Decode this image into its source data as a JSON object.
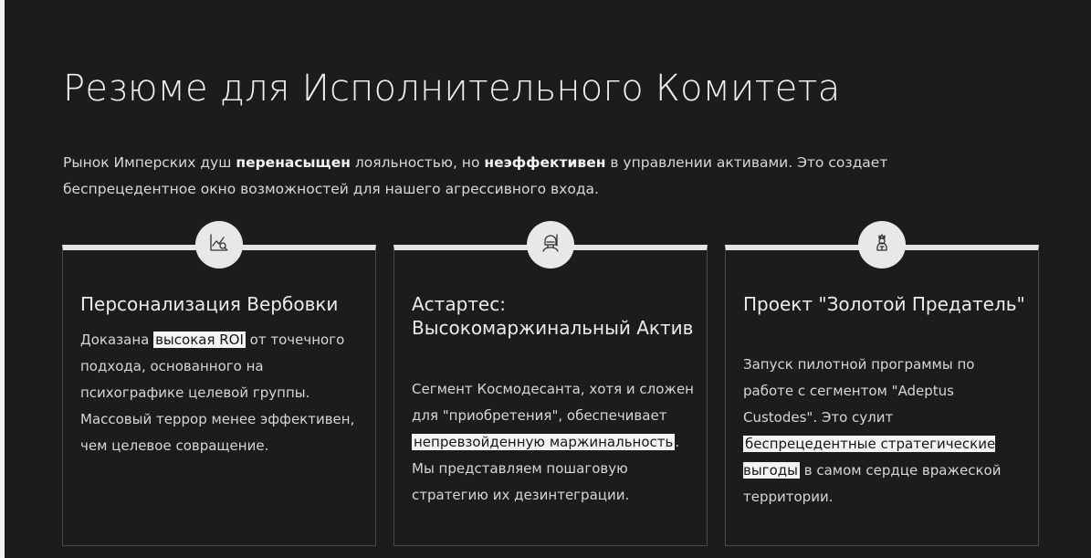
{
  "header": {
    "title": "Резюме для Исполнительного Комитета"
  },
  "intro": {
    "part1": "Рынок Имперских душ ",
    "bold1": "перенасыщен",
    "part2": " лояльностью, но ",
    "bold2": "неэффективен",
    "part3": " в управлении активами. Это создает беспрецедентное окно возможностей для нашего агрессивного входа."
  },
  "cards": [
    {
      "icon": "chart-analysis-icon",
      "title": "Персонализация Вербовки",
      "body_pre": "Доказана ",
      "highlight": "высокая ROI",
      "body_post": " от точечного подхода, основанного на психографике целевой группы. Массовый террор менее эффективен, чем целевое совращение."
    },
    {
      "icon": "armored-warrior-icon",
      "title": "Астартес: Высокомаржинальный Актив",
      "body_pre": "Сегмент Космодесанта, хотя и сложен для \"приобретения\", обеспечивает ",
      "highlight": "непревзойденную маржинальность",
      "body_post": ". Мы представляем пошаговую стратегию их дезинтеграции."
    },
    {
      "icon": "golden-guardian-icon",
      "title": "Проект \"Золотой Предатель\"",
      "body_pre": "Запуск пилотной программы по работе с сегментом \"Adeptus Custodes\". Это сулит ",
      "highlight": "беспрецедентные стратегические выгоды",
      "body_post": " в самом сердце вражеской территории."
    }
  ],
  "colors": {
    "background": "#1c1c1c",
    "accent": "#e6e6e6",
    "text": "#d6d6d6"
  }
}
